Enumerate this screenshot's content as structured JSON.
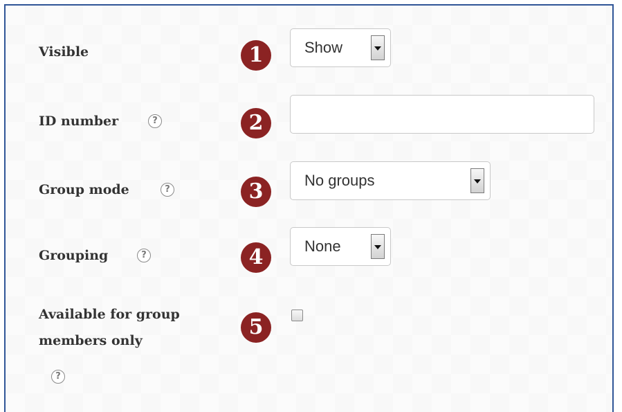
{
  "fields": {
    "visible": {
      "label": "Visible",
      "badge": "1",
      "value": "Show"
    },
    "id_number": {
      "label": "ID number",
      "badge": "2",
      "help": "?",
      "value": ""
    },
    "group_mode": {
      "label": "Group mode",
      "badge": "3",
      "help": "?",
      "value": "No groups"
    },
    "grouping": {
      "label": "Grouping",
      "badge": "4",
      "help": "?",
      "value": "None"
    },
    "available_for_group_members_only": {
      "label_line1": "Available for group",
      "label_line2": "members only",
      "badge": "5",
      "help": "?",
      "checked": false
    }
  },
  "colors": {
    "badge": "#8b2323",
    "frame_border": "#2f5597"
  },
  "icons": {
    "help": "help-icon",
    "dropdown": "chevron-down-icon"
  }
}
